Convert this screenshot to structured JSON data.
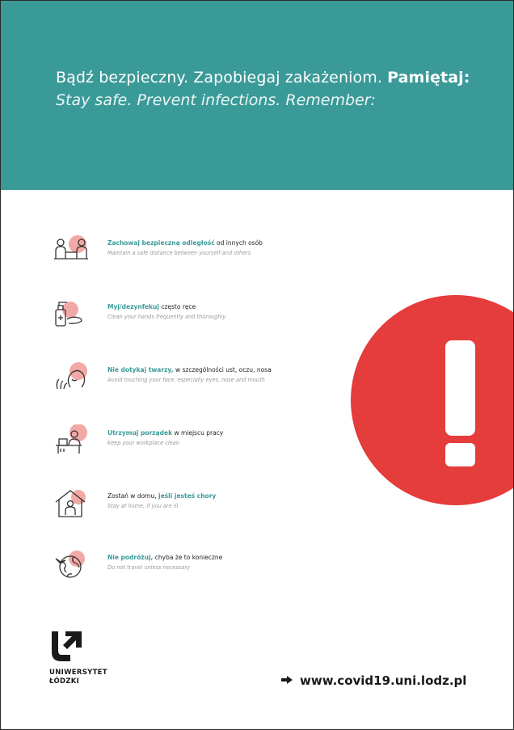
{
  "header": {
    "title_pl_regular": "Bądź bezpieczny. Zapobiegaj zakażeniom.",
    "title_pl_bold": "Pamiętaj:",
    "title_en": "Stay safe. Prevent infections. Remember:",
    "color": "#3a9a98"
  },
  "items": [
    {
      "icon": "distance-icon",
      "pl_pre": "",
      "pl_highlight": "Zachowaj bezpieczną odległość",
      "pl_post": " od innych osób",
      "en": "Maintain a safe distance between yourself and others"
    },
    {
      "icon": "hand-sanitizer-icon",
      "pl_pre": "",
      "pl_highlight": "Myj/dezynfekuj",
      "pl_post": " często ręce",
      "en": "Clean your hands frequently and thoroughly"
    },
    {
      "icon": "no-face-touch-icon",
      "pl_pre": "",
      "pl_highlight": "Nie dotykaj twarzy,",
      "pl_post": " w szczególności ust, oczu, nosa",
      "en": "Avoid touching your face, especially eyes, nose and mouth"
    },
    {
      "icon": "clean-workplace-icon",
      "pl_pre": "",
      "pl_highlight": "Utrzymuj porządek",
      "pl_post": " w miejscu pracy",
      "en": "Keep your workplace clean"
    },
    {
      "icon": "stay-home-icon",
      "pl_pre": "Zostań w domu, ",
      "pl_highlight": "jeśli jesteś chory",
      "pl_post": "",
      "en": "Stay at home, if you are ill"
    },
    {
      "icon": "no-travel-icon",
      "pl_pre": "",
      "pl_highlight": "Nie podróżuj,",
      "pl_post": " chyba że to konieczne",
      "en": "Do not travel unless necessary"
    }
  ],
  "alert": {
    "icon": "exclamation-icon",
    "color": "#e53c3c"
  },
  "footer": {
    "university_line1": "UNIWERSYTET",
    "university_line2": "ŁÓDZKI",
    "url": "www.covid19.uni.lodz.pl",
    "arrow_icon": "arrow-right-icon"
  }
}
